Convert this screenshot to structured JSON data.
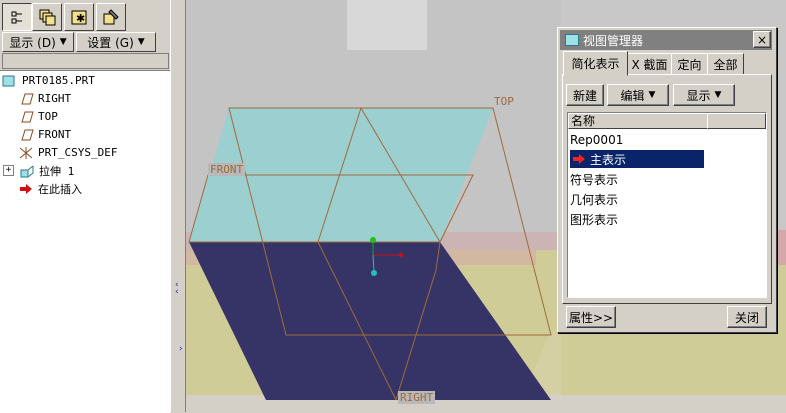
{
  "left_panel": {
    "toolbar_icons": [
      "tree-icon",
      "layers-icon",
      "settings-star-icon",
      "tools-icon"
    ],
    "display_btn": "显示 (D)",
    "settings_btn": "设置 (G)",
    "tree": [
      {
        "label": "PRT0185.PRT",
        "icon": "part-icon"
      },
      {
        "label": "RIGHT",
        "icon": "datum-plane-icon"
      },
      {
        "label": "TOP",
        "icon": "datum-plane-icon"
      },
      {
        "label": "FRONT",
        "icon": "datum-plane-icon"
      },
      {
        "label": "PRT_CSYS_DEF",
        "icon": "csys-icon"
      },
      {
        "label": "拉伸 1",
        "icon": "extrude-icon"
      },
      {
        "label": "在此插入",
        "icon": "insert-arrow-icon"
      }
    ],
    "expand_symbol": "+"
  },
  "canvas": {
    "labels": {
      "top": "TOP",
      "front": "FRONT",
      "right": "RIGHT"
    }
  },
  "dialog": {
    "title": "视图管理器",
    "close": "×",
    "tabs": [
      "简化表示",
      "X 截面",
      "定向",
      "全部"
    ],
    "new_btn": "新建",
    "edit_btn": "编辑",
    "show_btn": "显示",
    "list_header": "名称",
    "items": [
      "Rep0001",
      "主表示",
      "符号表示",
      "几何表示",
      "图形表示"
    ],
    "selected_index": 1,
    "properties_btn": "属性>>",
    "close_btn": "关闭"
  },
  "colors": {
    "top_face": "#9ccfd0",
    "front_face": "#363466",
    "dialog_title_bg": "#808080",
    "selection": "#0a246a",
    "datum_line": "#a06a3a"
  }
}
